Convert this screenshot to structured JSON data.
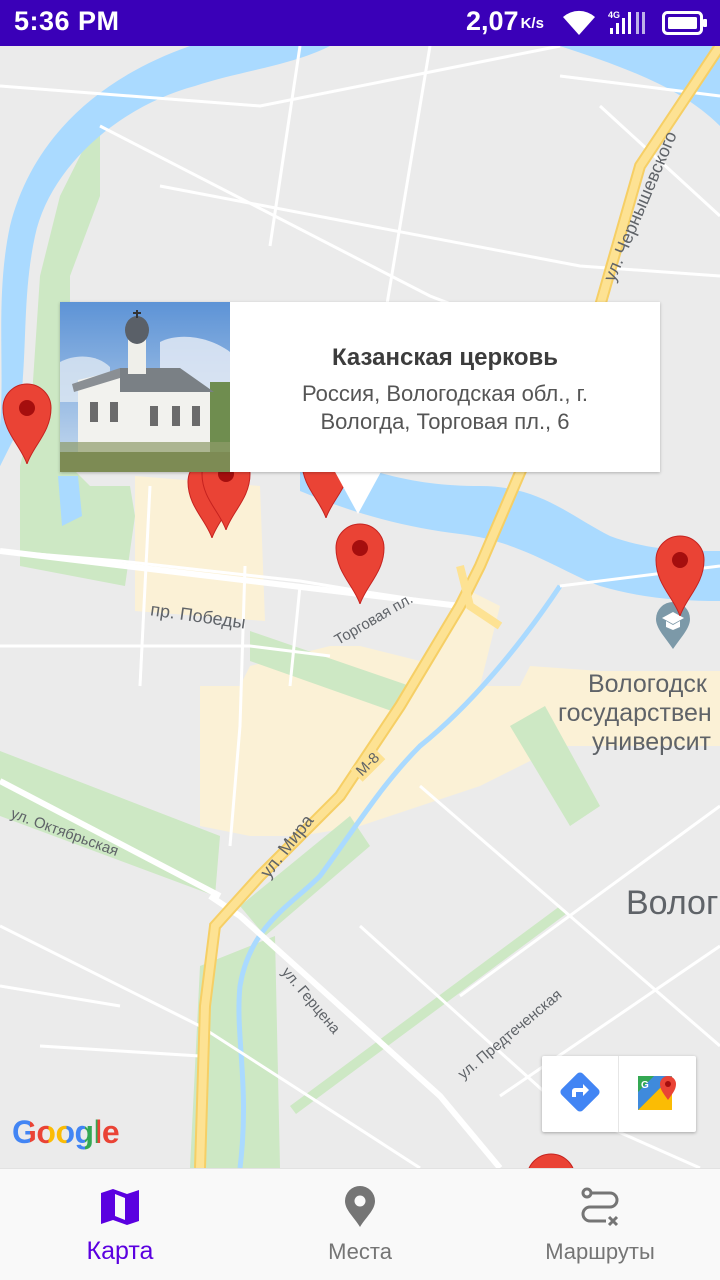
{
  "status_bar": {
    "time": "5:36 PM",
    "speed": "2,07",
    "speed_unit": "K/s",
    "network": "4G",
    "background_color": "#3a00b8"
  },
  "map": {
    "streets": {
      "chernyshevskogo": "ул. Чернышевского",
      "pobedy": "пр. Победы",
      "torgovaya": "Торговая пл.",
      "oktyabrskaya": "ул. Октябрьская",
      "mira": "ул. Мира",
      "gertsena": "ул. Герцена",
      "predtechenskaya": "ул. Предтеченская",
      "road_number": "М-8"
    },
    "poi": {
      "university_line1": "Вологодск",
      "university_line2": "государствен",
      "university_line3": "университ",
      "city": "Волог"
    },
    "info_window": {
      "title": "Казанская церковь",
      "address": "Россия, Вологодская обл., г. Вологда, Торговая пл., 6",
      "photo_icon": "church-photo"
    },
    "toolbar": {
      "directions_icon": "directions-icon",
      "open_maps_icon": "google-maps-icon"
    },
    "attribution": "Google",
    "marker_color": "#ea4335"
  },
  "bottom_nav": {
    "items": [
      {
        "label": "Карта",
        "icon": "map-icon",
        "active": true
      },
      {
        "label": "Места",
        "icon": "place-icon",
        "active": false
      },
      {
        "label": "Маршруты",
        "icon": "route-icon",
        "active": false
      }
    ],
    "accent_color": "#5b00e0"
  }
}
